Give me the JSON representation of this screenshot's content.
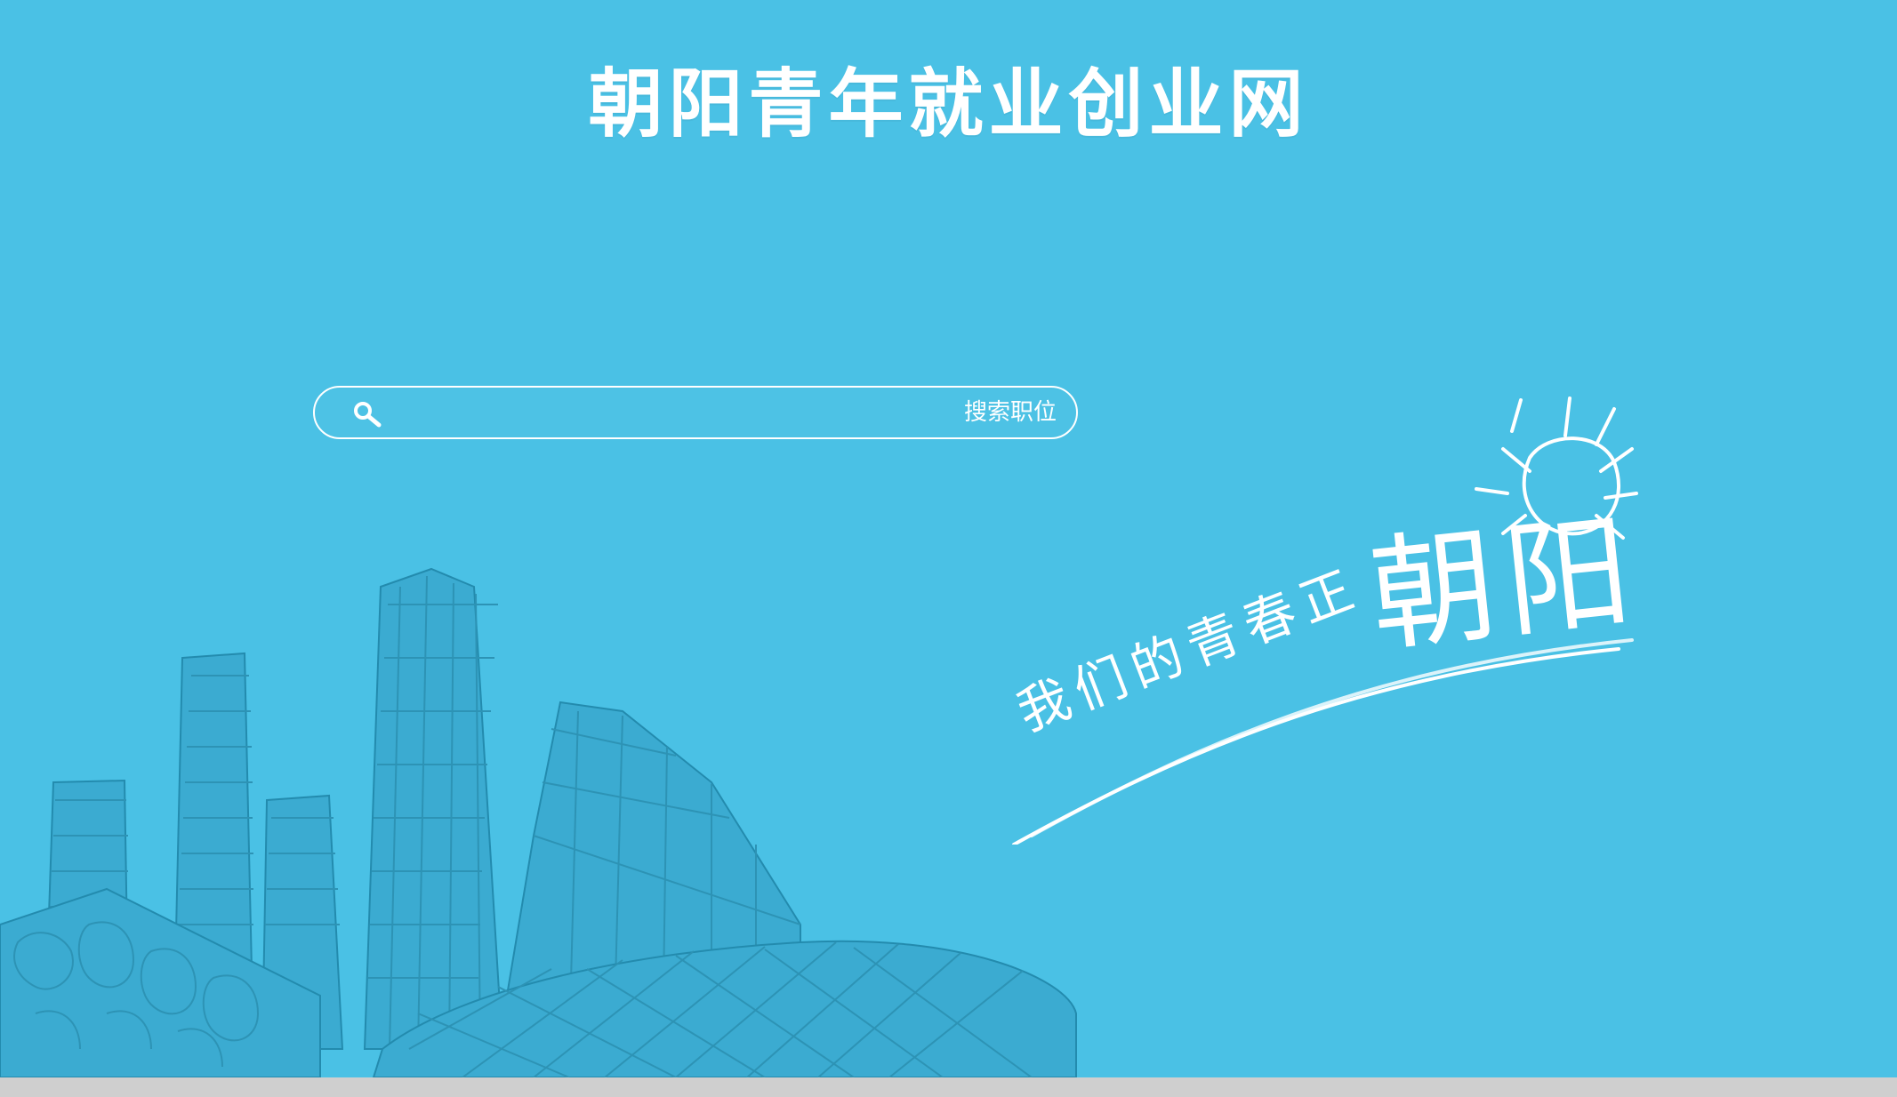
{
  "header": {
    "title": "朝阳青年就业创业网"
  },
  "search": {
    "placeholder": "",
    "button_label": "搜索职位"
  },
  "slogan": {
    "small_text": "我们的青春正",
    "big_text": "朝阳"
  },
  "colors": {
    "background": "#4ac1e5",
    "foreground": "#ffffff",
    "footer": "#cfcfcf"
  },
  "icons": {
    "search": "search-icon",
    "sun": "sun-icon"
  }
}
